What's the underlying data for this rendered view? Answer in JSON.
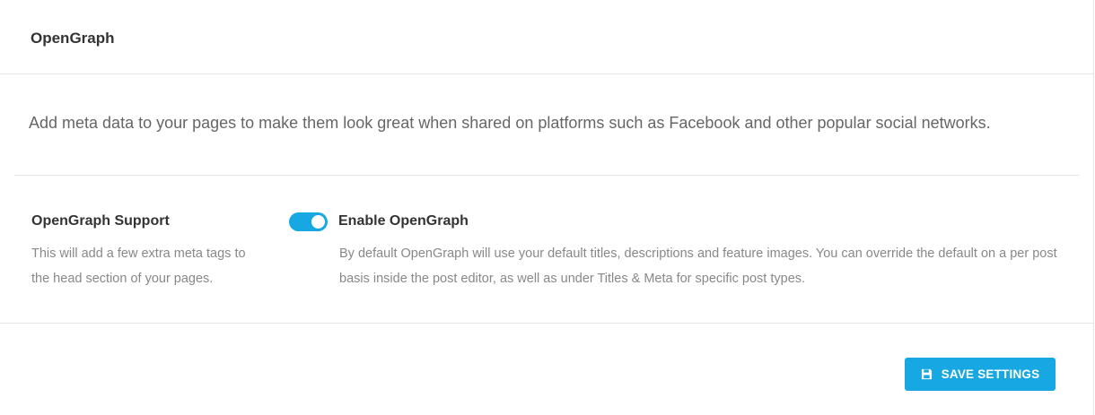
{
  "header": {
    "title": "OpenGraph"
  },
  "intro": {
    "text": "Add meta data to your pages to make them look great when shared on platforms such as Facebook and other popular social networks."
  },
  "setting": {
    "label": "OpenGraph Support",
    "label_desc": "This will add a few extra meta tags to the head section of your pages.",
    "toggle_label": "Enable OpenGraph",
    "toggle_on": true,
    "toggle_desc": "By default OpenGraph will use your default titles, descriptions and feature images. You can override the default on a per post basis inside the post editor, as well as under Titles & Meta for specific post types."
  },
  "footer": {
    "save_label": "SAVE SETTINGS",
    "save_icon": "floppy-disk-icon"
  },
  "colors": {
    "accent": "#17a8e3"
  }
}
